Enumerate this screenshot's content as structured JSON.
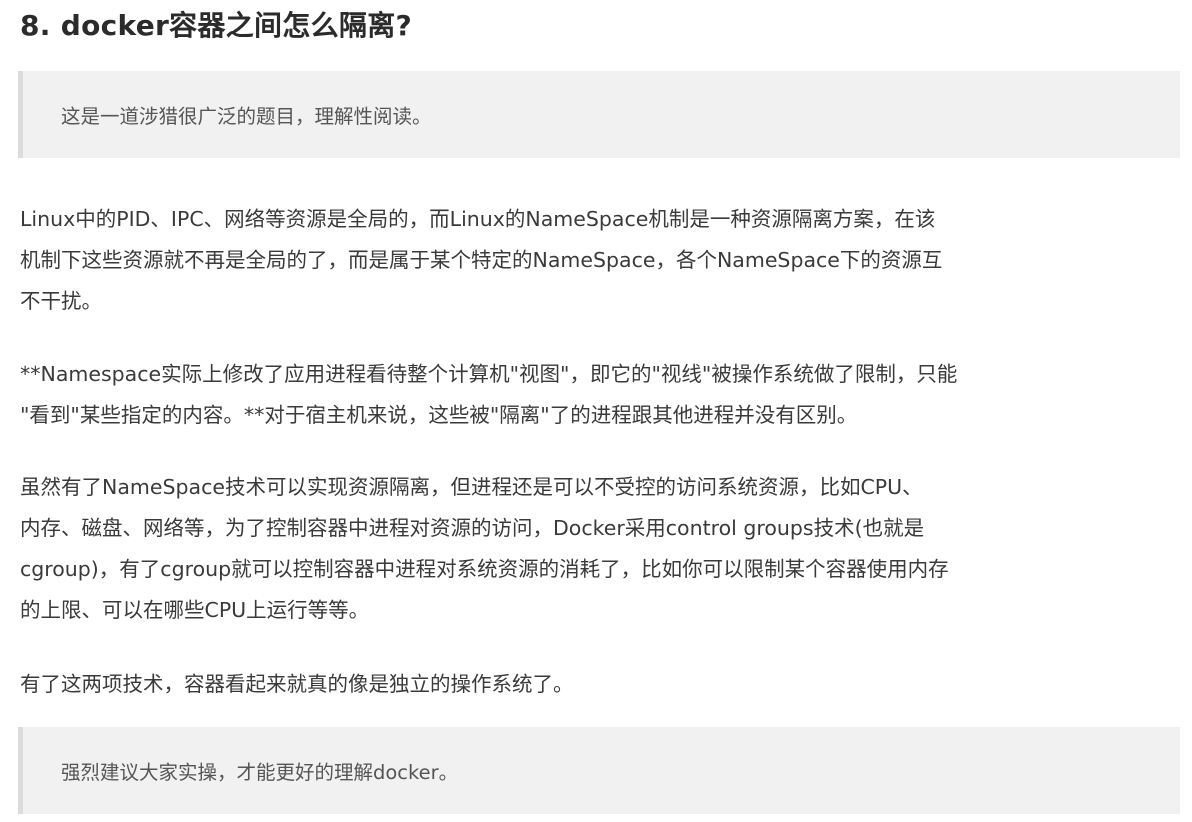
{
  "article": {
    "title": "8. docker容器之间怎么隔离?",
    "quote_top": "这是一道涉猎很广泛的题目，理解性阅读。",
    "paragraphs": [
      {
        "lines": [
          "Linux中的PID、IPC、网络等资源是全局的，而Linux的NameSpace机制是一种资源隔离方案，在该",
          "机制下这些资源就不再是全局的了，而是属于某个特定的NameSpace，各个NameSpace下的资源互",
          "不干扰。"
        ]
      },
      {
        "lines": [
          "**Namespace实际上修改了应用进程看待整个计算机\"视图\"，即它的\"视线\"被操作系统做了限制，只能",
          "\"看到\"某些指定的内容。**对于宿主机来说，这些被\"隔离\"了的进程跟其他进程并没有区别。"
        ]
      },
      {
        "lines": [
          "虽然有了NameSpace技术可以实现资源隔离，但进程还是可以不受控的访问系统资源，比如CPU、",
          "内存、磁盘、网络等，为了控制容器中进程对资源的访问，Docker采用control groups技术(也就是",
          "cgroup)，有了cgroup就可以控制容器中进程对系统资源的消耗了，比如你可以限制某个容器使用内存",
          "的上限、可以在哪些CPU上运行等等。"
        ]
      },
      {
        "lines": [
          "有了这两项技术，容器看起来就真的像是独立的操作系统了。"
        ]
      }
    ],
    "quote_bottom": "强烈建议大家实操，才能更好的理解docker。"
  }
}
